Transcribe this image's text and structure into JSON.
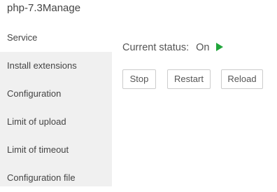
{
  "window": {
    "title": "php-7.3Manage"
  },
  "sidebar": {
    "items": [
      {
        "label": "Service",
        "active": true
      },
      {
        "label": "Install extensions",
        "active": false
      },
      {
        "label": "Configuration",
        "active": false
      },
      {
        "label": "Limit of upload",
        "active": false
      },
      {
        "label": "Limit of timeout",
        "active": false
      },
      {
        "label": "Configuration file",
        "active": false
      }
    ]
  },
  "main": {
    "status_label": "Current status:",
    "status_value": "On",
    "status_icon": "play-icon",
    "status_color": "#20a53a",
    "buttons": {
      "stop": "Stop",
      "restart": "Restart",
      "reload": "Reload"
    }
  }
}
